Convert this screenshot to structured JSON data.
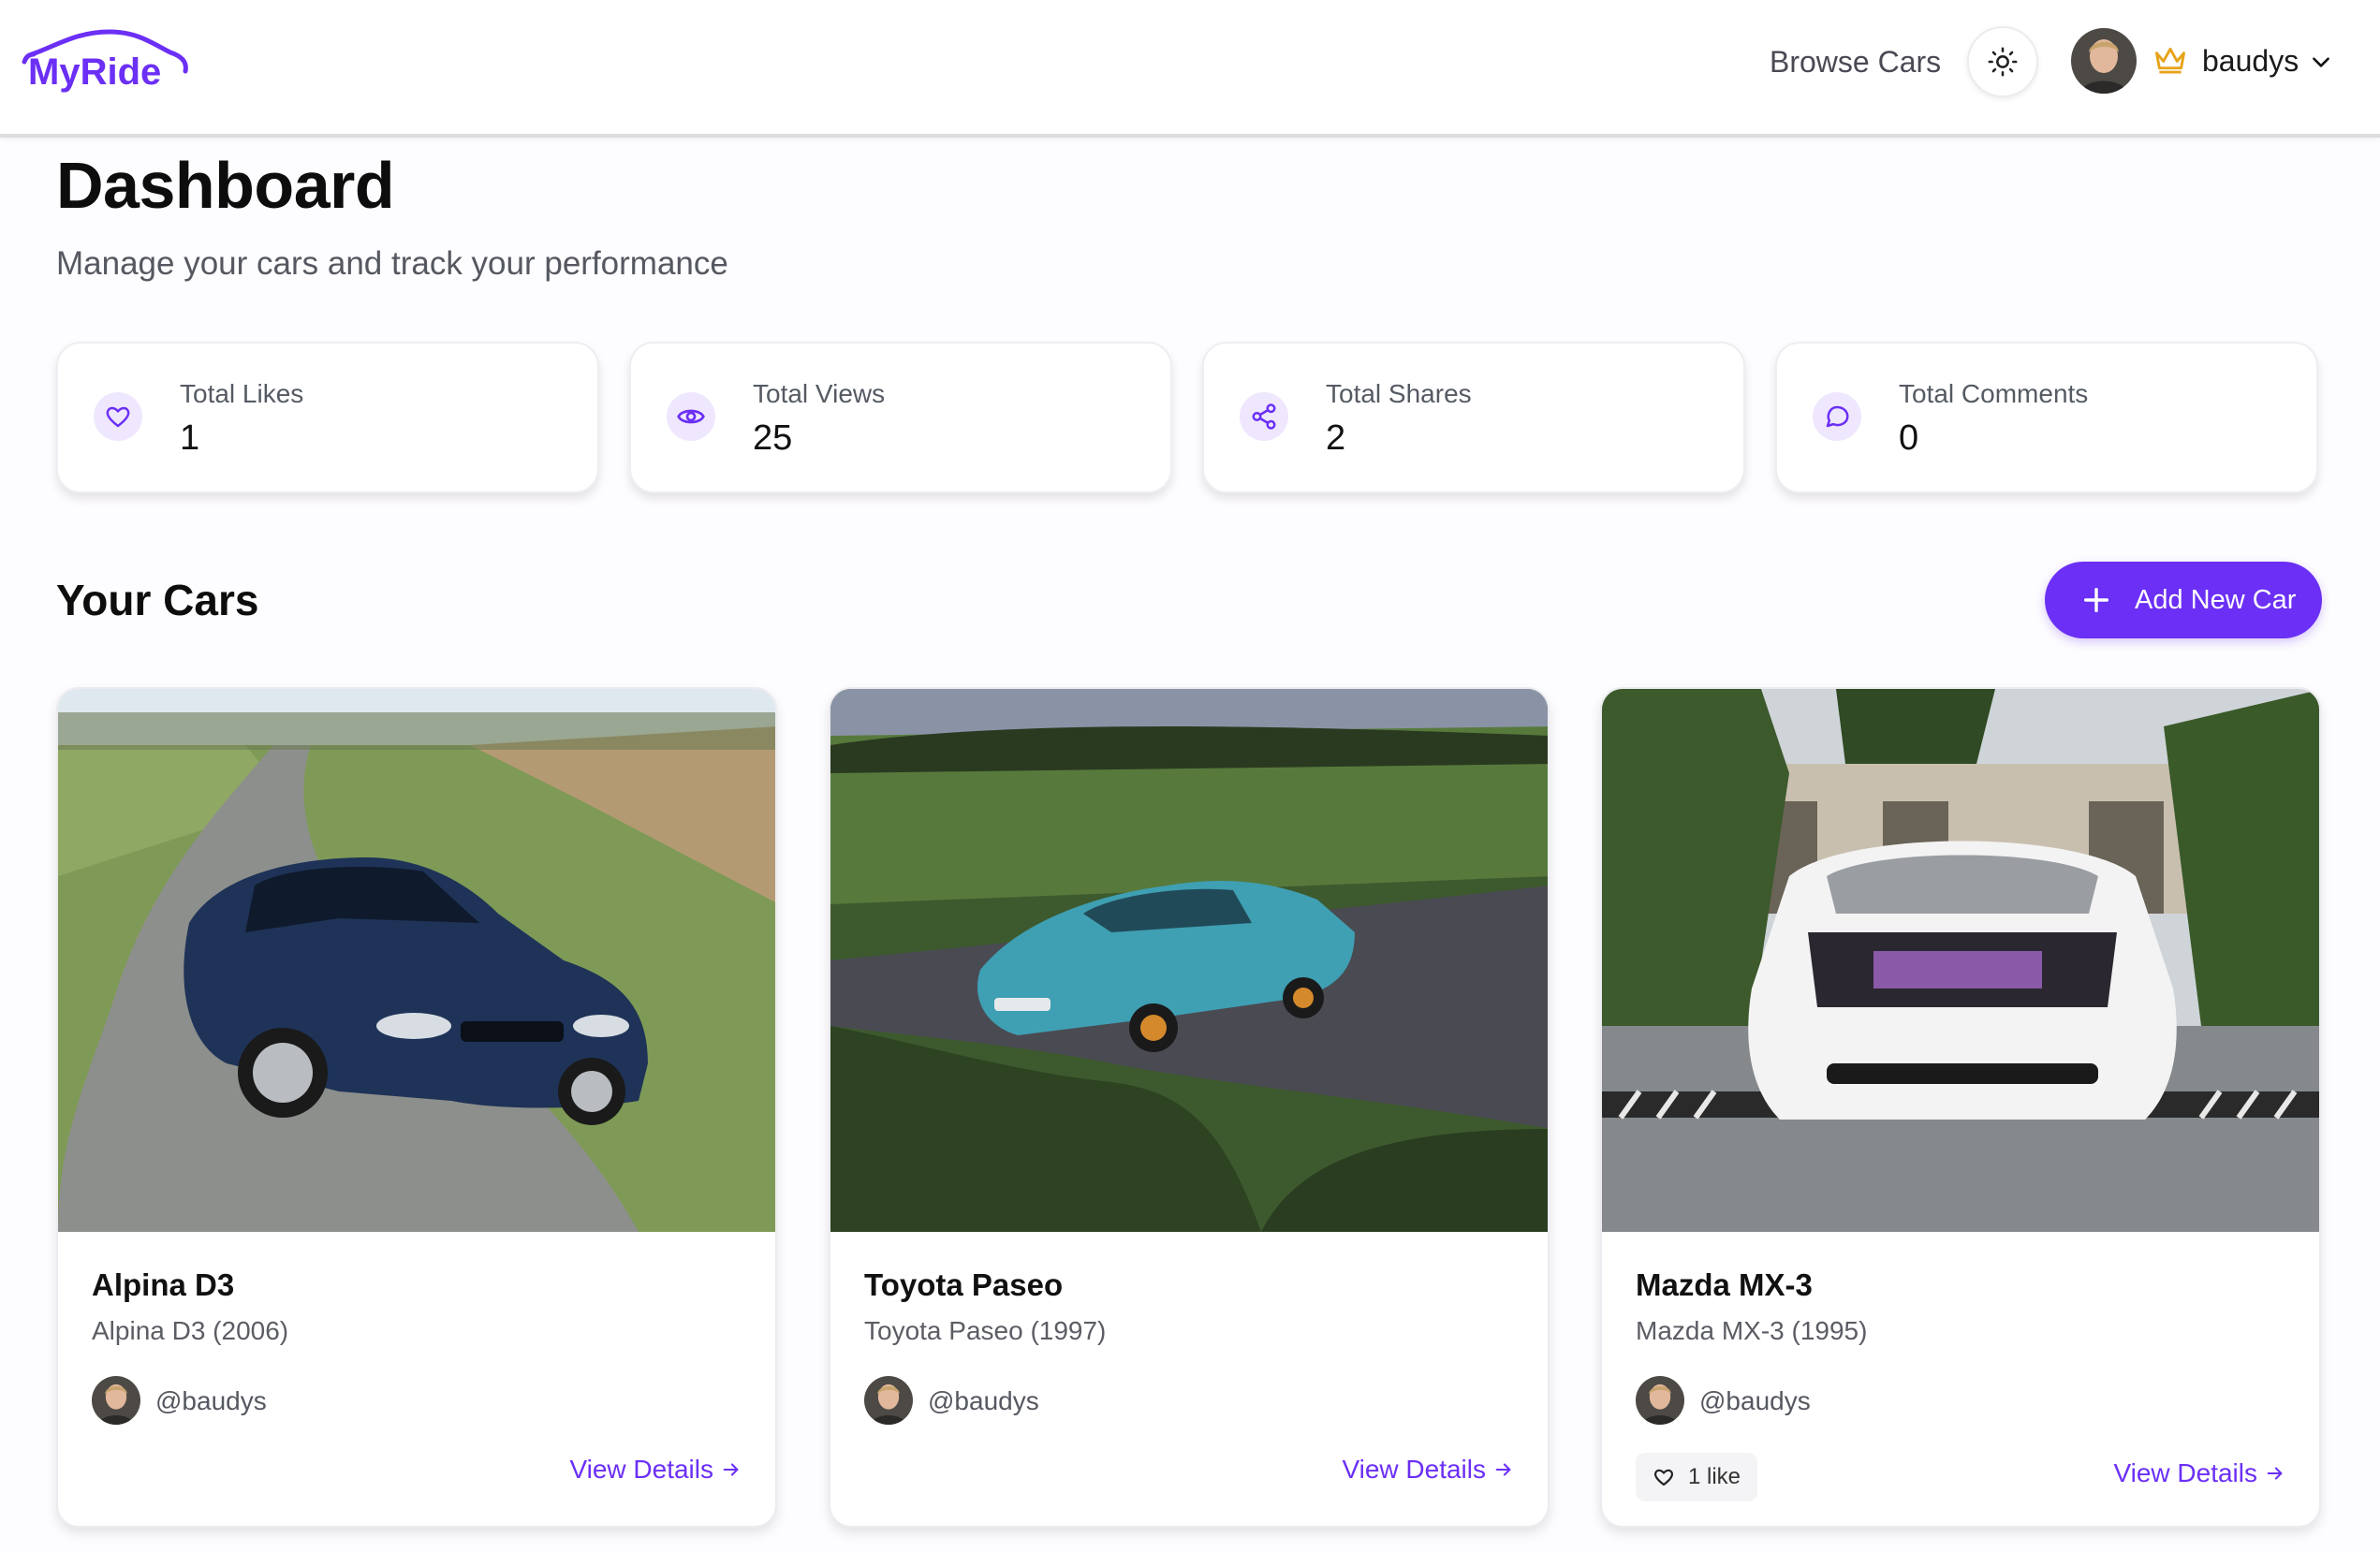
{
  "app": {
    "logo_text": "MyRide",
    "brand_color": "#6b2ff5"
  },
  "header": {
    "browse_label": "Browse Cars",
    "theme_icon": "sun-icon",
    "user": {
      "name": "baudys",
      "badge_icon": "crown-icon"
    }
  },
  "page": {
    "title": "Dashboard",
    "subtitle": "Manage your cars and track your performance"
  },
  "stats": [
    {
      "label": "Total Likes",
      "value": "1",
      "icon": "heart-icon"
    },
    {
      "label": "Total Views",
      "value": "25",
      "icon": "eye-icon"
    },
    {
      "label": "Total Shares",
      "value": "2",
      "icon": "share-icon"
    },
    {
      "label": "Total Comments",
      "value": "0",
      "icon": "comment-icon"
    }
  ],
  "cars_section": {
    "title": "Your Cars",
    "add_label": "Add New Car"
  },
  "cars": [
    {
      "name": "Alpina D3",
      "subtitle": "Alpina D3 (2006)",
      "owner": "@baudys",
      "details_label": "View Details",
      "likes": "",
      "car_color": "#1e3357"
    },
    {
      "name": "Toyota Paseo",
      "subtitle": "Toyota Paseo (1997)",
      "owner": "@baudys",
      "details_label": "View Details",
      "likes": "",
      "car_color": "#3f9fb3"
    },
    {
      "name": "Mazda MX-3",
      "subtitle": "Mazda MX-3 (1995)",
      "owner": "@baudys",
      "details_label": "View Details",
      "likes": "1 like",
      "car_color": "#f3f3f3"
    }
  ]
}
